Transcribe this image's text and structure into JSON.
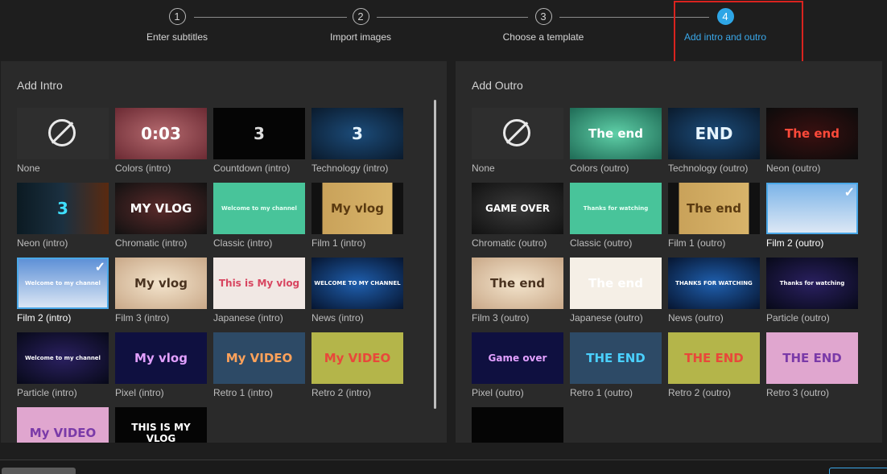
{
  "steps": [
    {
      "num": "1",
      "label": "Enter subtitles"
    },
    {
      "num": "2",
      "label": "Import images"
    },
    {
      "num": "3",
      "label": "Choose a template"
    },
    {
      "num": "4",
      "label": "Add intro and outro"
    }
  ],
  "intro": {
    "title": "Add Intro",
    "items": [
      {
        "label": "None",
        "thumb_text": "",
        "bg": "#2e2e2e",
        "color": "#fff"
      },
      {
        "label": "Colors (intro)",
        "thumb_text": "0:03",
        "bg": "radial-gradient(#b56a6f,#6b2a33)",
        "color": "#fff"
      },
      {
        "label": "Countdown (intro)",
        "thumb_text": "3",
        "bg": "#050505",
        "color": "#ddd"
      },
      {
        "label": "Technology (intro)",
        "thumb_text": "3",
        "bg": "radial-gradient(#1c4c7a,#0a1a2c)",
        "color": "#e6f4ff"
      },
      {
        "label": "Neon (intro)",
        "thumb_text": "3",
        "bg": "linear-gradient(90deg,#0b1a22,#1b3040,#5a2a10)",
        "color": "#3fe0ff"
      },
      {
        "label": "Chromatic (intro)",
        "thumb_text": "MY VLOG",
        "bg": "radial-gradient(#5a2a2a,#111)",
        "color": "#fff"
      },
      {
        "label": "Classic (intro)",
        "thumb_text": "Welcome to my channel",
        "bg": "#48c49a",
        "color": "#e8fff5"
      },
      {
        "label": "Film 1 (intro)",
        "thumb_text": "My vlog",
        "bg": "linear-gradient(90deg,#111 12%,#c9a25a 12%,#d8b46a 88%,#111 88%)",
        "color": "#5a3a10"
      },
      {
        "label": "Film 2 (intro)",
        "thumb_text": "Welcome to my channel",
        "bg": "linear-gradient(#5a8ed6,#dfe9f5)",
        "color": "#fff",
        "selected": true
      },
      {
        "label": "Film 3 (intro)",
        "thumb_text": "My vlog",
        "bg": "radial-gradient(#f3e4cc,#c9a888)",
        "color": "#4a3320"
      },
      {
        "label": "Japanese (intro)",
        "thumb_text": "This is My vlog",
        "bg": "#f1e8e4",
        "color": "#d84560"
      },
      {
        "label": "News (intro)",
        "thumb_text": "WELCOME TO MY CHANNEL",
        "bg": "radial-gradient(#1f5fae,#061530)",
        "color": "#fff"
      },
      {
        "label": "Particle (intro)",
        "thumb_text": "Welcome to my channel",
        "bg": "radial-gradient(#2a2060,#070918)",
        "color": "#fff"
      },
      {
        "label": "Pixel (intro)",
        "thumb_text": "My vlog",
        "bg": "#0f1040",
        "color": "#e2a0ff"
      },
      {
        "label": "Retro 1 (intro)",
        "thumb_text": "My VIDEO",
        "bg": "#2d4a66",
        "color": "#ffa25a"
      },
      {
        "label": "Retro 2 (intro)",
        "thumb_text": "My VIDEO",
        "bg": "#b4b54a",
        "color": "#e8483a"
      },
      {
        "label": "",
        "thumb_text": "My VIDEO",
        "bg": "#e0a6cf",
        "color": "#7a3aa8"
      },
      {
        "label": "",
        "thumb_text": "THIS IS MY VLOG",
        "bg": "#050505",
        "color": "#fff"
      }
    ]
  },
  "outro": {
    "title": "Add Outro",
    "items": [
      {
        "label": "None",
        "thumb_text": "",
        "bg": "#2e2e2e",
        "color": "#fff"
      },
      {
        "label": "Colors (outro)",
        "thumb_text": "The end",
        "bg": "radial-gradient(#5fd0a8,#1e6a55)",
        "color": "#fff"
      },
      {
        "label": "Technology (outro)",
        "thumb_text": "END",
        "bg": "radial-gradient(#1c4c7a,#0a1a2c)",
        "color": "#e6f4ff"
      },
      {
        "label": "Neon (outro)",
        "thumb_text": "The end",
        "bg": "radial-gradient(#3a1010,#0b0b0b)",
        "color": "#ff4a3a"
      },
      {
        "label": "Chromatic (outro)",
        "thumb_text": "GAME OVER",
        "bg": "radial-gradient(#3a3a3a,#111)",
        "color": "#fff"
      },
      {
        "label": "Classic (outro)",
        "thumb_text": "Thanks for watching",
        "bg": "#48c49a",
        "color": "#e8fff5"
      },
      {
        "label": "Film 1 (outro)",
        "thumb_text": "The end",
        "bg": "linear-gradient(90deg,#111 12%,#c9a25a 12%,#d8b46a 88%,#111 88%)",
        "color": "#5a3a10"
      },
      {
        "label": "Film 2 (outro)",
        "thumb_text": "",
        "bg": "linear-gradient(#7ab3e8,#dfe9f5)",
        "color": "#fff",
        "selected": true
      },
      {
        "label": "Film 3 (outro)",
        "thumb_text": "The end",
        "bg": "radial-gradient(#f3e4cc,#c9a888)",
        "color": "#4a3320"
      },
      {
        "label": "Japanese (outro)",
        "thumb_text": "The end",
        "bg": "#f5efe6",
        "color": "#fff"
      },
      {
        "label": "News (outro)",
        "thumb_text": "THANKS FOR WATCHING",
        "bg": "radial-gradient(#1f5fae,#061530)",
        "color": "#fff"
      },
      {
        "label": "Particle (outro)",
        "thumb_text": "Thanks for watching",
        "bg": "radial-gradient(#2a2060,#070918)",
        "color": "#fff"
      },
      {
        "label": "Pixel (outro)",
        "thumb_text": "Game over",
        "bg": "#0f1040",
        "color": "#e2a0ff"
      },
      {
        "label": "Retro 1 (outro)",
        "thumb_text": "THE END",
        "bg": "#2d4a66",
        "color": "#4ad0ff"
      },
      {
        "label": "Retro 2 (outro)",
        "thumb_text": "THE END",
        "bg": "#b4b54a",
        "color": "#e8483a"
      },
      {
        "label": "Retro 3 (outro)",
        "thumb_text": "THE END",
        "bg": "#e0a6cf",
        "color": "#7a3aa8"
      },
      {
        "label": "",
        "thumb_text": "",
        "bg": "#050505",
        "color": "#fff"
      }
    ]
  }
}
